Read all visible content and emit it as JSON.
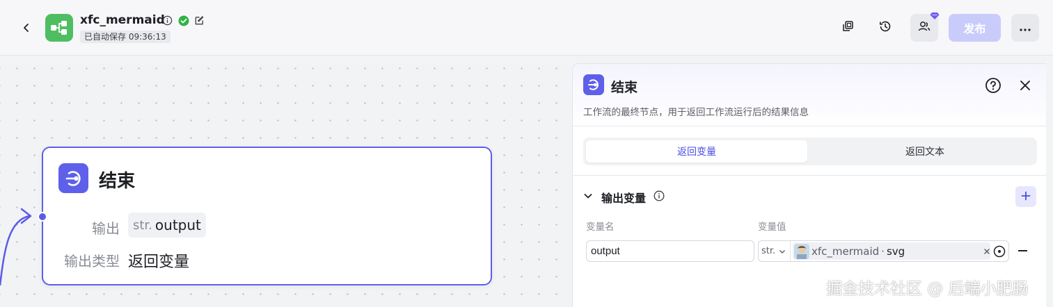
{
  "header": {
    "app_title": "xfc_mermaid",
    "autosave_text": "已自动保存 09:36:13",
    "publish_label": "发布",
    "accent_color": "#5e60ea",
    "app_logo_color": "#4fbe63"
  },
  "node": {
    "title": "结束",
    "output_label": "输出",
    "output_type_badge": "str.",
    "output_var": "output",
    "output_kind_label": "输出类型",
    "output_kind_value": "返回变量"
  },
  "panel": {
    "title": "结束",
    "description": "工作流的最终节点，用于返回工作流运行后的结果信息",
    "tabs": [
      {
        "label": "返回变量",
        "active": true
      },
      {
        "label": "返回文本",
        "active": false
      }
    ],
    "section_title": "输出变量",
    "columns": {
      "name": "变量名",
      "value": "变量值"
    },
    "rows": [
      {
        "name": "output",
        "type": "str.",
        "ref_node": "xfc_mermaid",
        "ref_sep": "·",
        "ref_var": "svg"
      }
    ]
  },
  "watermark": "掘金技术社区 @ 后端小肥肠"
}
